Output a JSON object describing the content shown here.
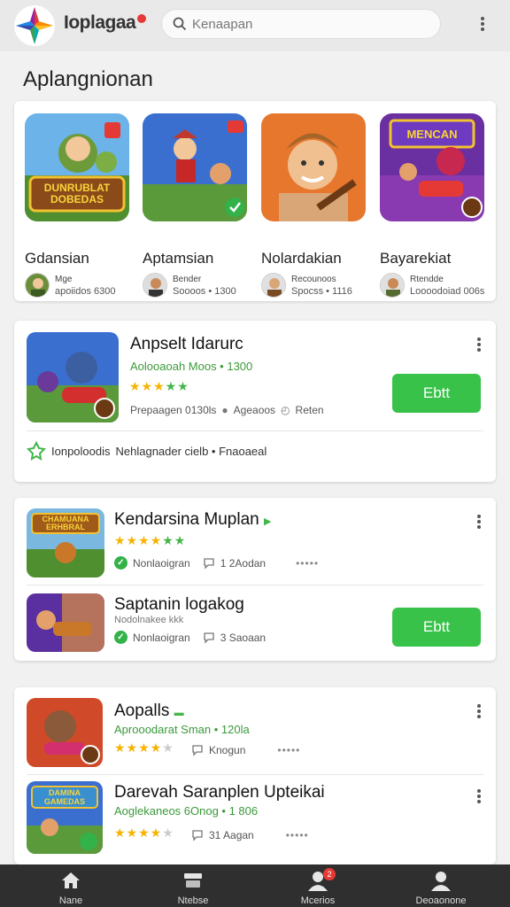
{
  "header": {
    "title": "Ioplagaa",
    "search_placeholder": "Kenaapan"
  },
  "section_title": "Aplangnionan",
  "featured": [
    {
      "name": "Gdansian",
      "dev": "Mge",
      "meta": "apoiidos 6300",
      "banner": "DUNRUBLAT DOBEDAS"
    },
    {
      "name": "Aptamsian",
      "dev": "Bender",
      "meta": "Soooos • 1300",
      "banner": ""
    },
    {
      "name": "Nolardakian",
      "dev": "Recounoos",
      "meta": "Spocss • 1116",
      "banner": ""
    },
    {
      "name": "Bayarekiat",
      "dev": "Rtendde",
      "meta": "Loooodoiad 006s",
      "banner": "MENCAN"
    }
  ],
  "card1": {
    "name": "Anpselt Idarurc",
    "sub": "Aolooaoah Moos • 1300",
    "rating": 5,
    "info": [
      "Prepaagen 0130ls",
      "Ageaoos",
      "Reten"
    ],
    "button": "Ebtt",
    "footer_label": "Ionpoloodis",
    "footer_text": "Nehlagnader cielb • Fnaoaeal"
  },
  "card2": {
    "rows": [
      {
        "name": "Kendarsina Muplan",
        "sub": "",
        "rating": 6,
        "check_text": "Nonlaoigran",
        "comments": "1 2Aodan",
        "button": ""
      },
      {
        "name": "Saptanin logakog",
        "sub": "Nodolnakee kkk",
        "rating": 0,
        "check_text": "Nonlaoigran",
        "comments": "3 Saoaan",
        "button": "Ebtt"
      }
    ],
    "banner": "CHAMUANA ERHBRAL"
  },
  "card3": {
    "rows": [
      {
        "name": "Aopalls",
        "sub": "Aprooodarat Sman • 120la",
        "rating": 4,
        "comments": "Knogun"
      },
      {
        "name": "Darevah Saranplen Upteikai",
        "sub": "Aoglekaneos 6Onog • 1 806",
        "rating": 4,
        "comments": "31 Aagan"
      }
    ],
    "banner": "DAMINA GAMEDAS"
  },
  "nav": [
    {
      "label": "Nane",
      "icon": "home-icon"
    },
    {
      "label": "Ntebse",
      "icon": "stack-icon"
    },
    {
      "label": "Mcerios",
      "icon": "people-icon",
      "badge": "2"
    },
    {
      "label": "Deoaonone",
      "icon": "profile-icon"
    }
  ],
  "colors": {
    "accent_green": "#39c24a",
    "star_gold": "#f5b400",
    "nav_bg": "#2f2f2f",
    "badge_red": "#e53935"
  }
}
